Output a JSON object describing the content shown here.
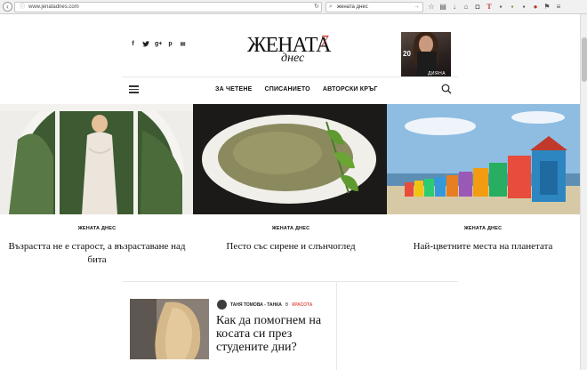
{
  "browser": {
    "url": "www.jenatadnes.com",
    "search_value": "жената днес",
    "back_icon": "back-arrow-icon",
    "toolbar_icons": [
      "star-icon",
      "clipboard-icon",
      "download-icon",
      "home-icon",
      "pocket-icon",
      "t-icon",
      "extension-icon",
      "extension-icon",
      "adblock-icon",
      "flag-icon",
      "menu-icon"
    ]
  },
  "header": {
    "social_icons": [
      "f",
      "t",
      "g+",
      "p",
      "✉"
    ],
    "logo_main": "ЖЕНАТА",
    "logo_sub": "днес",
    "logo_badge": "7",
    "cover_number": "20",
    "cover_name": "ДИЯНА"
  },
  "nav": {
    "items": [
      "ЗА ЧЕТЕНЕ",
      "СПИСАНИЕТО",
      "АВТОРСКИ КРЪГ"
    ]
  },
  "articles": [
    {
      "category": "ЖЕНАТА ДНЕС",
      "title": "Възрастта не е старост, а възраставане над бита"
    },
    {
      "category": "ЖЕНАТА ДНЕС",
      "title": "Песто със сирене и слънчоглед"
    },
    {
      "category": "ЖЕНАТА ДНЕС",
      "title": "Най-цветните места на планетата"
    }
  ],
  "featured": {
    "author": "ТАНЯ ТОМОВА - ТАНКА",
    "in_label": "В",
    "topic": "КРАСОТА",
    "title": "Как да помогнем на косата си през студените дни?"
  }
}
